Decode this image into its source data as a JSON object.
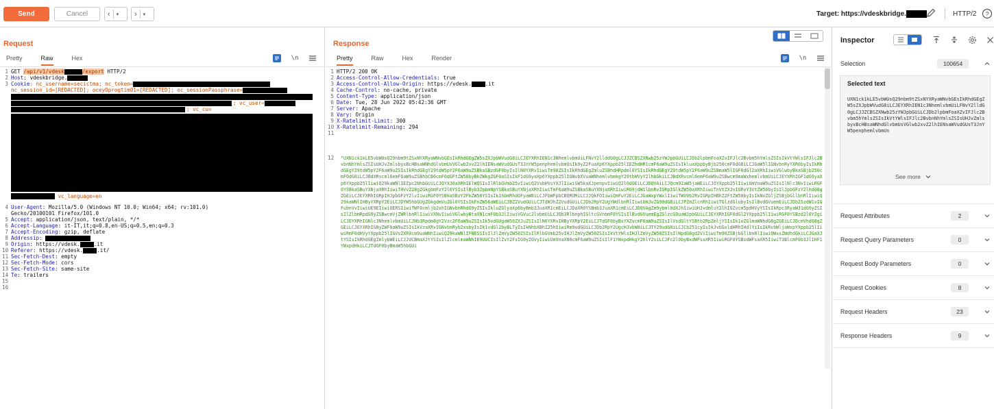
{
  "toolbar": {
    "send_label": "Send",
    "cancel_label": "Cancel",
    "target_label": "Target: https://vdeskbridge.",
    "protocol_label": "HTTP/2"
  },
  "request": {
    "title": "Request",
    "tabs": [
      "Pretty",
      "Raw",
      "Hex"
    ],
    "active_tab": "Raw",
    "lines": {
      "l1_method": "GET ",
      "l1_path_a": "/api/v1/vdesk",
      "l1_path_b": "/export",
      "l1_proto": " HTTP/2",
      "l2_key": "Host",
      "l2_val": ": vdeskbridge.",
      "l3_key": "Cookie",
      "l3_val": ": nc_username=secictma; nc_token=",
      "l3b_val": "nc_session_id=[REDACTED]; oceyOprogtim01=[REDACTED]; oc_sessionPassphrase=",
      "l3c_val": "; vc_user=",
      "l3d_val": "; vc_cu=",
      "l3e_val": " vc_language=en",
      "l4_key": "User-Agent",
      "l4_val": ": Mozilla/5.0 (Windows NT 10.0; Win64; x64; rv:101.0)",
      "l4b_val": "Gecko/20100101 Firefox/101.0",
      "l5_key": "Accept",
      "l5_val": ": application/json, text/plain, */*",
      "l6_key": "Accept-Language",
      "l6_val": ": it-IT,it;q=0.8,en-US;q=0.5,en;q=0.3",
      "l7_key": "Accept-Encoding",
      "l7_val": ": gzip, deflate",
      "l8_key": "Addressip",
      "l8_val": ": ",
      "l9_key": "Origin",
      "l9_val": ": https://vdesk.",
      "l9_end": ".it",
      "l10_key": "Referer",
      "l10_val": ": https://vdesk.",
      "l10_end": ".it/",
      "l11_key": "Sec-Fetch-Dest",
      "l11_val": ": empty",
      "l12_key": "Sec-Fetch-Mode",
      "l12_val": ": cors",
      "l13_key": "Sec-Fetch-Site",
      "l13_val": ": same-site",
      "l14_key": "Te",
      "l14_val": ": trailers"
    }
  },
  "response": {
    "title": "Response",
    "tabs": [
      "Pretty",
      "Raw",
      "Hex",
      "Render"
    ],
    "active_tab": "Pretty",
    "lines": {
      "l1": "HTTP/2 200 OK",
      "l2_key": "Access-Control-Allow-Credentials",
      "l2_val": ": true",
      "l3_key": "Access-Control-Allow-Origin",
      "l3_val": ": https://vdesk.",
      "l3_end": ".it",
      "l4_key": "Cache-Control",
      "l4_val": ": no-cache, private",
      "l5_key": "Content-Type",
      "l5_val": ": application/json",
      "l6_key": "Date",
      "l6_val": ": Tue, 28 Jun 2022 05:42:36 GMT",
      "l7_key": "Server",
      "l7_val": ": Apache",
      "l8_key": "Vary",
      "l8_val": ": Origin",
      "l9_key": "X-Ratelimit-Limit",
      "l9_val": ": 300",
      "l10_key": "X-Ratelimit-Remaining",
      "l10_val": ": 294"
    },
    "body_blob": "\"UXN1ck1kLE5vbWUsQ29nbm9tZSxNYXRyaWNvbGEsIkRhdGEgZW5sZXJpbWVudG8iLCJEYXRhIEN1c3NhemlvbmUiLFNvY2llddG0gLCJJZCBSZXNwb25zYWJpbGUiLCJDb2lpbmFoaXZvIFJlc2Bvbm5hYmlsZSIsIkVtYWlsIFJlc2BvbnNhYmlsZSIsUHJvZmlsbyxBcHBsaWNhdGlvbmUsVGlwb2xvZ2lhIENsaWVudGUsT3JnYW5penphemlvbmUsIk9yZ2FuaXp6YXppb25lIEZhdHR1cmF6aW9uZSIsIkluaXppbyBjb250cmF0dG8iLCJGaW5lIGNvbnRyYXR0byIsIkRhdGEgY29tdW5pY2F6aW9uZSIsIkRhdGEgY29tdW5pY2F6aW9uZSBkaSBzdGF0byIsIlN0YXRvIiwiTm90ZSIsIkRhdGEgZmluZSBhdHRpdml0YSIsIkRhdGEgY29tdW5pY2F6aW9uZSBmaW5lIGF0dGl2aXRhIiwiVGlwbyBkaSBjb250cmF0dG8iLCJBdXRvcml6emF6aW9uZSBhbCB0cmF0dGFtZW50byBkZWkgZGF0aSIsIkF1dG9yaXp6YXppb25lIGNvbXVuaWNhemlvbmkgY29tbWVyY2lhbGkiLCJBdXRvcml6emF6aW9uZSBwcm9maWxhemlvbmUiLCJEYXRhIGF1dG9yaXp6YXppb25lIiwiQ29kaWNlIEZpc2NhbGUiLCJQYXJ0aXRhIElWQSIsIlRlbGVmb25vIiwiQ2VsbHVsYXJlIiwiSW5kaXJpenpvIiwiQ2l0dGEiLCJDQVAiLCJQcm92aW5jaWEiLCJOYXppb25lIiwiUmVnaW9uZSIsIlNlc3NvIiwiRGF0YSBkaSBuYXNjaXRhIiwiTHVvZ28gZGkgbmFzY2l0YSIsIlByb3ZpbmNpYSBkaSBuYXNjaXRhIiwiTmF6aW9uZSBkaSBuYXNjaXRhIiwiRG9jdW1lbnRvIGRpIGlkZW50aXRhIiwiTnVtZXJvIGRvY3VtZW50byIsIlJpbGFzY2lhdG8gZGEiLCJEYXRhIGRpIHJpbGFzY2lvIiwiRGF0YSBkaSBzY2FkZW56YSIsIk1hbmRhdGFyaW8iLCJFbWFpbCBQRUMiLCJJQkFOIiwiQmFuY2EiLCJGaWxpYWxlIiwiTWV0b2RvIGRpIHBhZ2FtZW50byIsIkNvZGljZSBjbGllbnRlIiwiQ29kaWNlIHByYXRpY2EiLCJDYW5hbGUgZGkgdmVuZGl0YSIsIkFnZW56aWEiLCJBZ2VudGUiLCJTdWJhZ2VudGUiLCJDb2RpY2UgYWdlbnRlIiwiUHJvZG90dG8iLCJPZmZlcnRhIiwiTGlzdGlubyIsIlBvdGVuemEiLCJDb25zdW1vIGFubnVvIiwiUE9EIiwiUERSIiwiTWF0cmljb2xhIGNvbnRhdG9yZSIsIkluZGlyaXp6byBmb3JuaXR1cmEiLCJDaXR0YSBmb3JuaXR1cmEiLCJDQVAgZm9ybml0dXJhIiwiUHJvdmluY2lhIGZvcm5pdHVyYSIsIkRpc3RyaWJ1dG9yZSIsIlZlbmRpdG9yZSBwcmVjZWRlbnRlIiwiVXNvIiwiVGlwbyBtaXN1cmF0b3JlIiwiVGVuc2lvbmUiLCJQb3RlbnphIGltcGVnbmF0YSIsIlBvdGVuemEgZGlzcG9uaWJpbGUiLCJEYXRhIGF0dGl2YXppb25lIiwiRGF0YSBzd2l0Y2giLCJEYXRhIGNlc3NhemlvbmUiLCJNb3Rpdm8gY2Vzc2F6aW9uZSIsIk5vdGUgaW50ZXJuZSIsIlN0YXRvIHByYXRpY2EiLCJTdGF0byBsYXZvcmF6aW9uZSIsIlVsdGltYSBtb2RpZmljYSIsIk1vZGlmaWNhdG8gZGEiLCJDcmVhdG8gZGEiLCJEYXRhIGNyZWF6aW9uZSIsIkVzaXRvIGNvbnRyb2xsbyIsIk1vdGl2byBLTyIsIkNhbXBhZ25hIiwiRm9udGUiLCJDb2RpY2UgcHJvbW8iLCJTY29udG8iLCJCb251cyIsIkJvbGxldHRhIHdlYiIsIkRvbWljaWxpYXppb25lIiwiRmF0dHVyYXppb25lIGVsZXR0cm9uaWNhIiwiQ29kaWNlIFNESSIsIlJlZmVyZW50ZSIsIlRlbGVmb25vIHJlZmVyZW50ZSIsIkVtYWlsIHJlZmVyZW50ZSIsIlNpdG8gd2ViIiwiTm90ZSBjbGllbnRlIiwiQWxsZWdhdGkiLCJGaXJtYSIsIkRhdGEgZmlybWEiLCJJUCBmaXJtYSIsIlZlcmlmaWNhIE9UUCIsIlZvY2FsIG9yZGVyIiwiUmVnaXN0cmF6aW9uZSIsIlF1YWxpdHkgY2hlY2siLCJFc2l0byBxdWFsaXR5IiwiRGF0YSBxdWFsaXR5IiwiT3BlcmF0b3JlIHF1YWxpdHkiLCJTdGF0byBmaW5hbGUi",
    "line_numbers": [
      "1",
      "2",
      "3",
      "4",
      "5",
      "6",
      "7",
      "8",
      "9",
      "10",
      "11",
      "12"
    ]
  },
  "inspector": {
    "title": "Inspector",
    "selection_label": "Selection",
    "selection_count": "100654",
    "selected_text_title": "Selected text",
    "selected_text": "UXN1ck1kLE5vbWUsQ29nbm9tZSxNYXRyaWNvbGEsIkRhdGEgZW5sZXJpbWVudG8iLCJEYXRhIEN1c3NhemlvbmUiLFNvY2lldG0gLCJJZCBSZXNwb25zYWJpbGUiLCJDb2lpbmFoaXZvIFJlc2Bvbm5hYmlsZSIsIkVtYWlsIFJlc2BvbnNhYmlsZSIsUHJvZmlsbyxBcHBsaWNhdGlvbmUsVGlwb2xvZ2lhIENsaWVudGUsT3JnYW5penphemlvbmUs",
    "see_more": "See more",
    "sections": [
      {
        "label": "Request Attributes",
        "count": "2"
      },
      {
        "label": "Request Query Parameters",
        "count": "0"
      },
      {
        "label": "Request Body Parameters",
        "count": "0"
      },
      {
        "label": "Request Cookies",
        "count": "8"
      },
      {
        "label": "Request Headers",
        "count": "23"
      },
      {
        "label": "Response Headers",
        "count": "9"
      }
    ]
  },
  "colors": {
    "accent": "#e8632e",
    "send_button": "#f26b3a",
    "header_key": "#1a1ab8",
    "json_green": "#3c8f1e",
    "toggle_blue": "#2e6ec4"
  }
}
